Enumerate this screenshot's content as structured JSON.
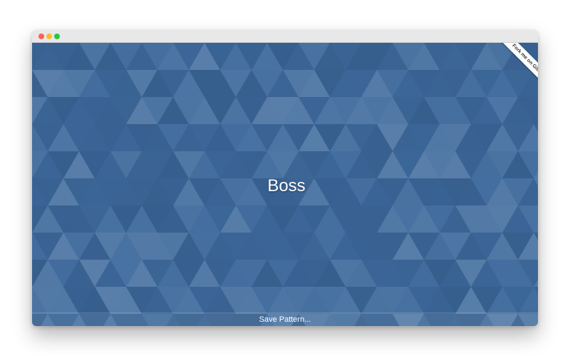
{
  "window": {
    "controls": [
      {
        "name": "close",
        "color": "#ff5f57"
      },
      {
        "name": "minimize",
        "color": "#febc2e"
      },
      {
        "name": "zoom",
        "color": "#28c840"
      }
    ]
  },
  "pattern": {
    "base_color": "#3e6a9c",
    "style": "triangles"
  },
  "title_input": {
    "value": "Boss"
  },
  "save_button": {
    "label": "Save Pattern..."
  },
  "ribbon": {
    "label": "Fork me on GitHub"
  }
}
